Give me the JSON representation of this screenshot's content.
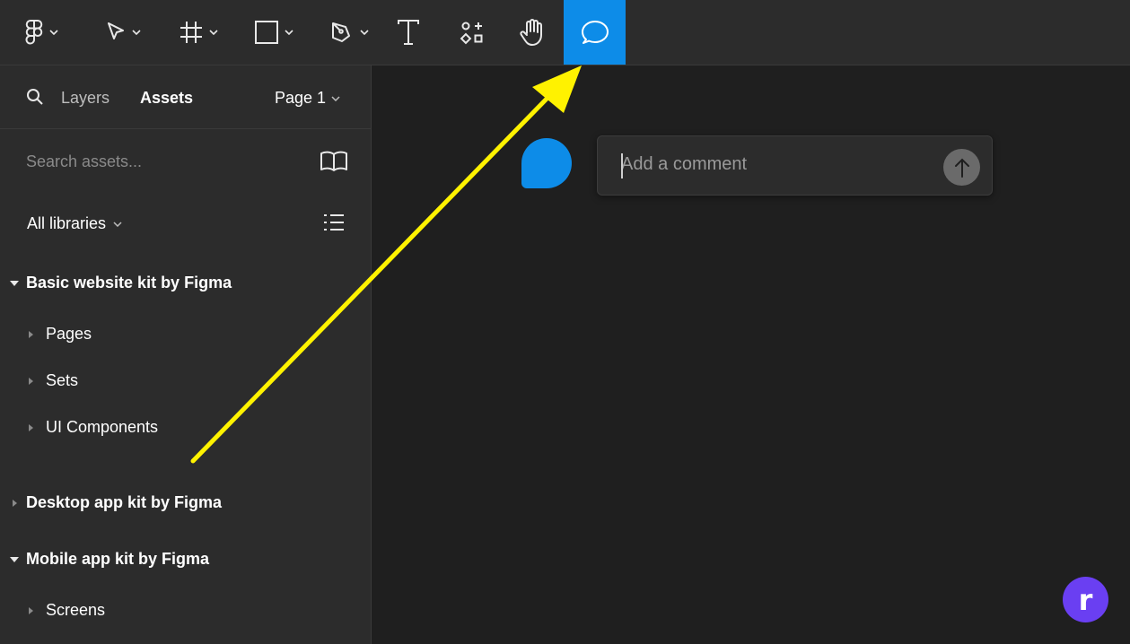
{
  "toolbar": {
    "tools": [
      {
        "name": "main-menu",
        "icon": "figma-logo-icon",
        "has_dropdown": true
      },
      {
        "name": "move",
        "icon": "move-cursor-icon",
        "has_dropdown": true
      },
      {
        "name": "frame",
        "icon": "frame-hash-icon",
        "has_dropdown": true
      },
      {
        "name": "shape",
        "icon": "rectangle-icon",
        "has_dropdown": true
      },
      {
        "name": "pen",
        "icon": "pen-nib-icon",
        "has_dropdown": true
      },
      {
        "name": "text",
        "icon": "text-t-icon",
        "has_dropdown": false
      },
      {
        "name": "resources",
        "icon": "components-icon",
        "has_dropdown": false
      },
      {
        "name": "hand",
        "icon": "hand-icon",
        "has_dropdown": false
      },
      {
        "name": "comment",
        "icon": "comment-bubble-icon",
        "has_dropdown": false,
        "active": true
      }
    ],
    "active_color": "#0d8ce8"
  },
  "sidebar": {
    "tabs": {
      "layers": "Layers",
      "assets": "Assets"
    },
    "page_selector": "Page 1",
    "search_placeholder": "Search assets...",
    "libraries_filter": "All libraries",
    "libraries": [
      {
        "name": "Basic website kit by Figma",
        "expanded": true,
        "children": [
          "Pages",
          "Sets",
          "UI Components"
        ]
      },
      {
        "name": "Desktop app kit by Figma",
        "expanded": false,
        "children": []
      },
      {
        "name": "Mobile app kit by Figma",
        "expanded": true,
        "children": [
          "Screens"
        ]
      }
    ]
  },
  "canvas": {
    "comment_placeholder": "Add a comment",
    "pin_color": "#0d8ce8"
  },
  "annotation": {
    "arrow_color": "#fff200"
  },
  "brand_badge": {
    "letter": "r",
    "color": "#6a3ff2"
  }
}
